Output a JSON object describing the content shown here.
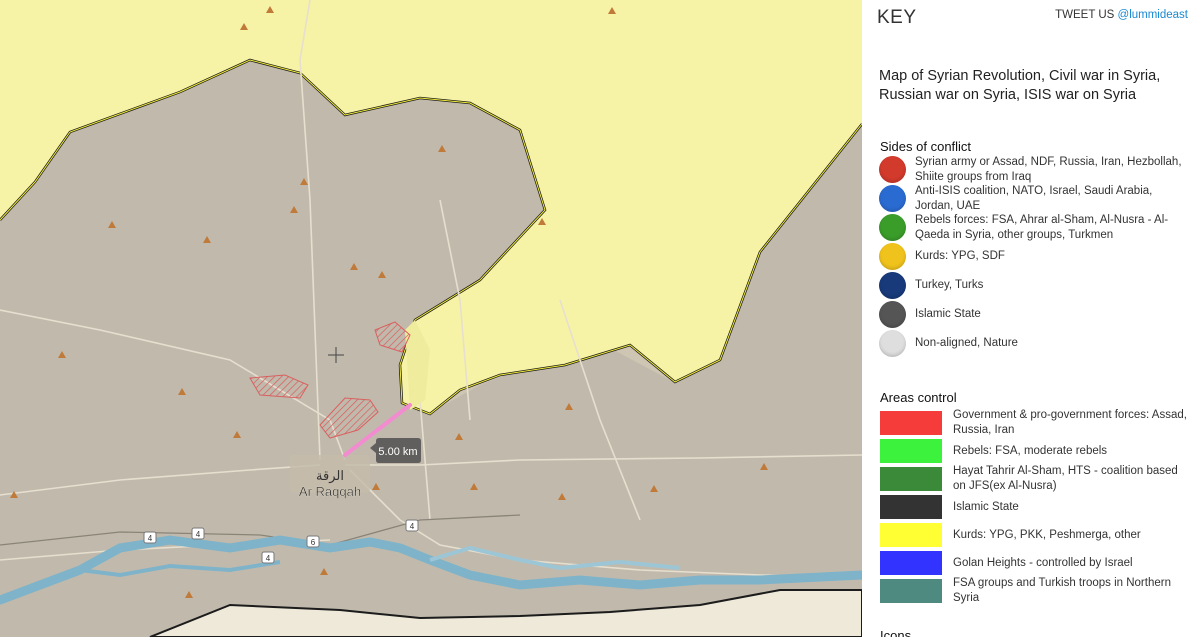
{
  "map": {
    "city_label_latin": "Ar Raqqah",
    "city_label_arabic": "الرقة",
    "distance_tooltip": "5.00 km",
    "road_shields": [
      "4",
      "4",
      "6",
      "4",
      "4"
    ],
    "colors": {
      "land": "#cfc5b3",
      "isis_tint": "#bdb5a8",
      "kurds": "#f7f3a6",
      "border": "#1c1c1c",
      "water": "#7fb3c9",
      "measure_line": "#f28bd0"
    }
  },
  "panel": {
    "key_title": "KEY",
    "tweet_prefix": "TWEET US ",
    "tweet_handle": "@lummideast",
    "description": "Map of Syrian Revolution, Civil war in Syria, Russian war on Syria, ISIS war on Syria",
    "sides_title": "Sides of conflict",
    "sides": [
      {
        "label": "Syrian army or Assad, NDF, Russia, Iran, Hezbollah, Shiite groups from Iraq",
        "color": "#d23a2c"
      },
      {
        "label": "Anti-ISIS coalition, NATO, Israel, Saudi Arabia, Jordan, UAE",
        "color": "#2a6bd1"
      },
      {
        "label": "Rebels forces: FSA, Ahrar al-Sham, Al-Nusra - Al-Qaeda in Syria, other groups, Turkmen",
        "color": "#3a9d2a"
      },
      {
        "label": "Kurds: YPG, SDF",
        "color": "#f0c21c"
      },
      {
        "label": "Turkey, Turks",
        "color": "#183a7a"
      },
      {
        "label": "Islamic State",
        "color": "#555555"
      },
      {
        "label": "Non-aligned, Nature",
        "color": "#dedede"
      }
    ],
    "areas_title": "Areas control",
    "areas": [
      {
        "label": "Government & pro-government forces: Assad, Russia, Iran",
        "color": "#f63b3b"
      },
      {
        "label": "Rebels: FSA, moderate rebels",
        "color": "#3cf23c"
      },
      {
        "label": "Hayat Tahrir Al-Sham, HTS - coalition based on JFS(ex Al-Nusra)",
        "color": "#3a8a3a"
      },
      {
        "label": "Islamic State",
        "color": "#333333"
      },
      {
        "label": "Kurds: YPG, PKK, Peshmerga, other",
        "color": "#ffff33"
      },
      {
        "label": "Golan Heights - controlled by Israel",
        "color": "#3333ff"
      },
      {
        "label": "FSA groups and Turkish troops in Northern Syria",
        "color": "#4f8a80"
      }
    ],
    "icons_title": "Icons"
  }
}
